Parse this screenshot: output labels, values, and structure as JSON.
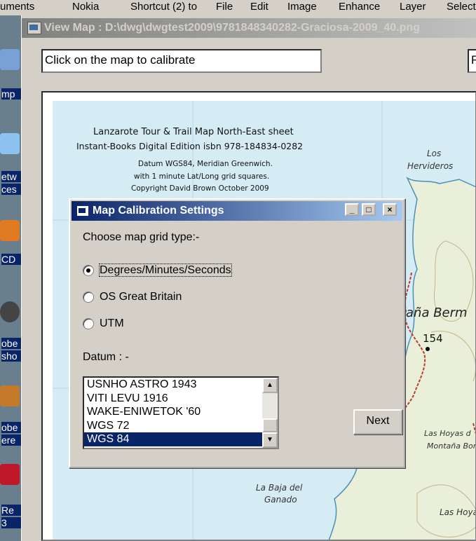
{
  "taskbar": {
    "items": [
      "uments",
      "Nokia",
      "Shortcut (2) to"
    ],
    "menu": [
      "File",
      "Edit",
      "Image",
      "Enhance",
      "Layer",
      "Select"
    ]
  },
  "desktop": {
    "labels": [
      "mp",
      "etw",
      "ces",
      "CD",
      "obe",
      "sho",
      "obe",
      "ere",
      "Re",
      "3"
    ]
  },
  "window": {
    "title": "View Map : D:\\dwg\\dwgtest2009\\9781848340282-Graciosa-2009_40.png",
    "instruction_text": "Click on the map to calibrate",
    "right_field_text": "F"
  },
  "map": {
    "title_line1": "Lanzarote Tour & Trail Map North-East sheet",
    "title_line2": "Instant-Books Digital Edition isbn 978-184834-0282",
    "datum_line": "Datum WGS84, Meridian Greenwich.",
    "grid_line": "with 1 minute Lat/Long grid squares.",
    "copyright_line": "Copyright David Brown October 2009",
    "place_los": "Los",
    "place_hervideros": "Hervideros",
    "place_montana_berm": "aña Berm",
    "height_154": "154",
    "place_las_hoyas": "Las Hoyas d",
    "place_montana_bom": "Montaña Bom",
    "place_la_baja": "La Baja del",
    "place_ganado": "Ganado",
    "place_las_hoyas2": "Las Hoya"
  },
  "dialog": {
    "title": "Map Calibration Settings",
    "grid_prompt": "Choose map grid type:-",
    "options": [
      {
        "label": "Degrees/Minutes/Seconds",
        "selected": true
      },
      {
        "label": "OS Great Britain",
        "selected": false
      },
      {
        "label": "UTM",
        "selected": false
      }
    ],
    "datum_label": "Datum : -",
    "datum_items": [
      "USNHO ASTRO 1943",
      "VITI LEVU 1916",
      "WAKE-ENIWETOK '60",
      "WGS 72",
      "WGS 84"
    ],
    "datum_selected": "WGS 84",
    "next_label": "Next",
    "minimize_label": "_",
    "maximize_label": "□",
    "close_label": "×"
  },
  "colors": {
    "active_title": "#0a246a",
    "face": "#d4d0c8",
    "map_water": "#d6ecf5",
    "map_land": "#e9efd8",
    "trail": "#c0392b"
  }
}
